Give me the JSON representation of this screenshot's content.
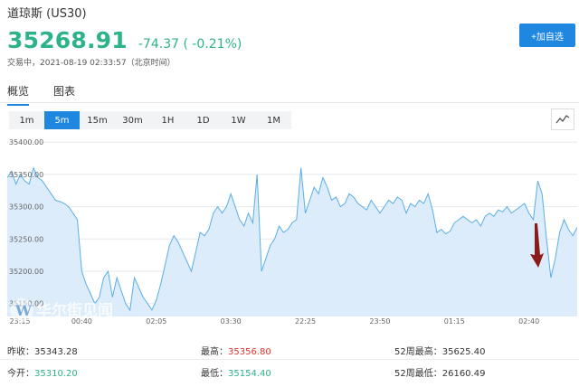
{
  "header": {
    "title": "道琼斯  (US30)",
    "price": "35268.91",
    "change": "-74.37 ( -0.21%)",
    "status": "交易中，2021-08-19 02:33:57（北京时间）",
    "add_button": "+加自选"
  },
  "tabs": [
    "概览",
    "图表"
  ],
  "intervals": [
    "1m",
    "5m",
    "15m",
    "30m",
    "1H",
    "1D",
    "1W",
    "1M"
  ],
  "active_interval": "5m",
  "watermark": "华尔街见闻",
  "chart_data": {
    "type": "area",
    "y_ticks": [
      "35400.00",
      "35350.00",
      "35300.00",
      "35250.00",
      "35200.00",
      "35150.00"
    ],
    "ylim": [
      35130,
      35410
    ],
    "x_ticks": [
      "23:15",
      "00:40",
      "02:05",
      "03:30",
      "22:25",
      "23:50",
      "01:15",
      "02:40"
    ],
    "x_tick_index": [
      0,
      17,
      34,
      51,
      68,
      85,
      102,
      119
    ],
    "values": [
      35345,
      35355,
      35335,
      35350,
      35340,
      35335,
      35360,
      35345,
      35340,
      35330,
      35320,
      35310,
      35308,
      35305,
      35300,
      35290,
      35280,
      35200,
      35180,
      35165,
      35150,
      35160,
      35190,
      35200,
      35160,
      35190,
      35170,
      35150,
      35140,
      35190,
      35175,
      35160,
      35150,
      35140,
      35155,
      35180,
      35210,
      35240,
      35255,
      35245,
      35230,
      35215,
      35200,
      35230,
      35260,
      35255,
      35265,
      35290,
      35300,
      35290,
      35300,
      35320,
      35300,
      35280,
      35270,
      35290,
      35275,
      35350,
      35200,
      35220,
      35240,
      35250,
      35270,
      35260,
      35265,
      35275,
      35280,
      35360,
      35290,
      35310,
      35330,
      35320,
      35345,
      35330,
      35310,
      35315,
      35300,
      35305,
      35320,
      35315,
      35305,
      35300,
      35295,
      35310,
      35300,
      35290,
      35300,
      35310,
      35305,
      35315,
      35310,
      35290,
      35305,
      35300,
      35310,
      35305,
      35320,
      35295,
      35260,
      35265,
      35258,
      35262,
      35275,
      35280,
      35285,
      35280,
      35275,
      35280,
      35270,
      35285,
      35290,
      35285,
      35295,
      35292,
      35300,
      35290,
      35295,
      35300,
      35305,
      35290,
      35280,
      35340,
      35320,
      35250,
      35190,
      35220,
      35260,
      35280,
      35265,
      35255,
      35268
    ],
    "line_color": "#5aaee6",
    "fill_color": "#dcecfa",
    "annotation_arrow_color": "#8b1a1a"
  },
  "stats": [
    {
      "label": "昨收：",
      "value": "35343.28",
      "tone": "normal"
    },
    {
      "label": "最高：",
      "value": "35356.80",
      "tone": "up"
    },
    {
      "label": "52周最高：",
      "value": "35625.40",
      "tone": "normal"
    },
    {
      "label": "今开：",
      "value": "35310.20",
      "tone": "dn"
    },
    {
      "label": "最低：",
      "value": "35154.40",
      "tone": "dn"
    },
    {
      "label": "52周最低：",
      "value": "26160.49",
      "tone": "normal"
    }
  ]
}
